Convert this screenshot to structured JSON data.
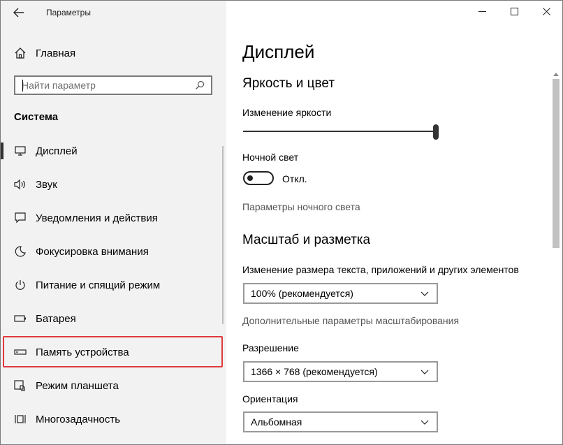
{
  "window": {
    "title": "Параметры",
    "controls": {
      "minimize_icon": "minimize-icon",
      "maximize_icon": "maximize-icon",
      "close_icon": "close-icon"
    }
  },
  "sidebar": {
    "home_label": "Главная",
    "search_placeholder": "Найти параметр",
    "section_title": "Система",
    "items": [
      {
        "label": "Дисплей",
        "icon": "display-icon",
        "selected": true
      },
      {
        "label": "Звук",
        "icon": "speaker-icon"
      },
      {
        "label": "Уведомления и действия",
        "icon": "notification-icon"
      },
      {
        "label": "Фокусировка внимания",
        "icon": "moon-icon"
      },
      {
        "label": "Питание и спящий режим",
        "icon": "power-icon"
      },
      {
        "label": "Батарея",
        "icon": "battery-icon"
      },
      {
        "label": "Память устройства",
        "icon": "storage-icon",
        "highlighted": true
      },
      {
        "label": "Режим планшета",
        "icon": "tablet-mode-icon"
      },
      {
        "label": "Многозадачность",
        "icon": "multitasking-icon"
      }
    ],
    "highlight_color": "#e0393e"
  },
  "main": {
    "page_title": "Дисплей",
    "brightness_section": {
      "title": "Яркость и цвет",
      "brightness_label": "Изменение яркости",
      "brightness_level": 1.0,
      "night_light_label": "Ночной свет",
      "night_light_state": "Откл.",
      "night_light_on": false,
      "night_light_settings_link": "Параметры ночного света"
    },
    "scale_section": {
      "title": "Масштаб и разметка",
      "scale_label": "Изменение размера текста, приложений и других элементов",
      "scale_value": "100% (рекомендуется)",
      "advanced_scaling_link": "Дополнительные параметры масштабирования",
      "resolution_label": "Разрешение",
      "resolution_value": "1366 × 768 (рекомендуется)",
      "orientation_label": "Ориентация",
      "orientation_value": "Альбомная"
    }
  }
}
